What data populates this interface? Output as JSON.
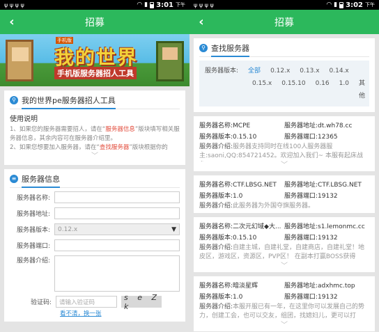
{
  "left": {
    "status": {
      "time": "3:01",
      "ampm": "下午",
      "icons": "ψ ψ ψ ψ"
    },
    "title": "招募",
    "banner": {
      "tag": "手机版",
      "title": "我的世界",
      "subtitle": "手机版服务器招人工具",
      "logo_text": "MINECRAFT PE"
    },
    "intro": {
      "title": "我的世界pe服务器招人工具",
      "usage_heading": "使用说明",
      "line1_a": "1、如果您的服务器需要招人，请在“",
      "line1_hl": "服务器信息",
      "line1_b": "”版块填写相关服务器信息，其余内容可在服务器介绍里。",
      "line2_a": "2、如果您想要加入服务器，请在“",
      "line2_hl": "查找服务器",
      "line2_b": "”版块根据你的"
    },
    "form": {
      "title": "服务器信息",
      "name_label": "服务器名称:",
      "address_label": "服务器地址:",
      "version_label": "服务器版本:",
      "version_value": "0.12.x",
      "port_label": "服务器端口:",
      "intro_label": "服务器介绍:",
      "captcha_label": "验证码:",
      "captcha_placeholder": "请输入验证码",
      "captcha_text": "s e Z k",
      "refresh_link": "看不清，换一张"
    }
  },
  "right": {
    "status": {
      "time": "3:02",
      "ampm": "下午",
      "icons": "ψ ψ ψ ψ"
    },
    "title": "招募",
    "search": {
      "title": "查找服务器",
      "version_label": "服务器版本:",
      "versions_row1": [
        "全部",
        "0.12.x",
        "0.13.x",
        "0.14.x"
      ],
      "versions_row2": [
        "0.15.x",
        "0.15.10",
        "0.16",
        "1.0",
        "其他"
      ]
    },
    "servers": [
      {
        "name": "服务器名称:MCPE",
        "address": "服务器地址:dt.wh78.cc",
        "version": "服务器版本:0.15.10",
        "port": "服务器端口:12365",
        "intro_label": "服务器介绍:",
        "intro": "服务器支持同时在线100人服务器服主:saoni,QQ:854721452。欢迎加入我们~ 本服有起床战争、"
      },
      {
        "name": "服务器名称:CTF.LBSG.NET",
        "address": "服务器地址:CTF.LBSG.NET",
        "version": "服务器版本:1.0",
        "port": "服务器端口:19132",
        "intro_label": "服务器介绍:",
        "intro": "此服务器为外国夺旗服务器。"
      },
      {
        "name": "服务器名称:二次元幻域◆大...",
        "address": "服务器地址:s1.lemonmc.cc",
        "version": "服务器版本:0.15.10",
        "port": "服务器端口:19132",
        "intro_label": "服务器介绍:",
        "intro": "自建主城，自建礼堂，自建商店，自建礼堂！地皮区，游戏区，资源区，PVP区！ 在副本打赢BOSS获得"
      },
      {
        "name": "服务器名称:暗淡星辉",
        "address": "服务器地址:adxhmc.top",
        "version": "服务器版本:1.0",
        "port": "服务器端口:19132",
        "intro_label": "服务器介绍:",
        "intro": "本服开服已有一年，在这里你可以发展自己的势力，创建工会，也可以交友，组团，找媳妇儿，更可以打"
      }
    ]
  }
}
